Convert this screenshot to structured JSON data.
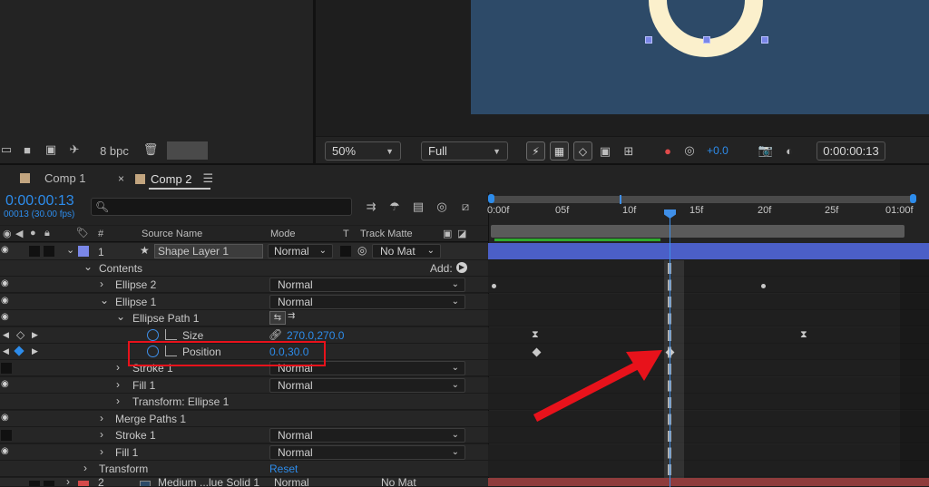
{
  "bottom_toolbar_left": {
    "bpc_label": "8 bpc"
  },
  "viewer_toolbar": {
    "zoom": "50%",
    "resolution": "Full",
    "exposure": "+0.0",
    "timecode": "0:00:00:13"
  },
  "tabs": [
    {
      "label": "Comp 1"
    },
    {
      "label": "Comp 2"
    }
  ],
  "timeline": {
    "timecode": "0:00:00:13",
    "frame_info": "00013 (30.00 fps)",
    "search_placeholder": "",
    "columns": {
      "num": "#",
      "source_name": "Source Name",
      "mode": "Mode",
      "t": "T",
      "track_matte": "Track Matte"
    },
    "ruler": [
      "0:00f",
      "05f",
      "10f",
      "15f",
      "20f",
      "25f",
      "01:00f"
    ],
    "rows": [
      {
        "num": "1",
        "name": "Shape Layer 1",
        "mode": "Normal",
        "matte": "No Mat"
      },
      {
        "name": "Contents",
        "add_label": "Add:"
      },
      {
        "name": "Ellipse 2",
        "mode": "Normal"
      },
      {
        "name": "Ellipse 1",
        "mode": "Normal"
      },
      {
        "name": "Ellipse Path 1"
      },
      {
        "name": "Size",
        "value": "270.0,270.0"
      },
      {
        "name": "Position",
        "value": "0.0,30.0"
      },
      {
        "name": "Stroke 1",
        "mode": "Normal"
      },
      {
        "name": "Fill 1",
        "mode": "Normal"
      },
      {
        "name": "Transform: Ellipse 1"
      },
      {
        "name": "Merge Paths 1"
      },
      {
        "name": "Stroke 1",
        "mode": "Normal"
      },
      {
        "name": "Fill 1",
        "mode": "Normal"
      },
      {
        "name": "Transform",
        "value": "Reset"
      },
      {
        "num": "2",
        "name": "Medium ...lue Solid 1",
        "mode": "Normal",
        "matte": "No Mat"
      }
    ]
  },
  "colors": {
    "accent_blue": "#2d8ceb",
    "comp_bg": "#2d4a68",
    "highlight_red": "#e8121b",
    "layer_bar": "#4b5fc7",
    "solid_bar": "#8f3c3c"
  }
}
